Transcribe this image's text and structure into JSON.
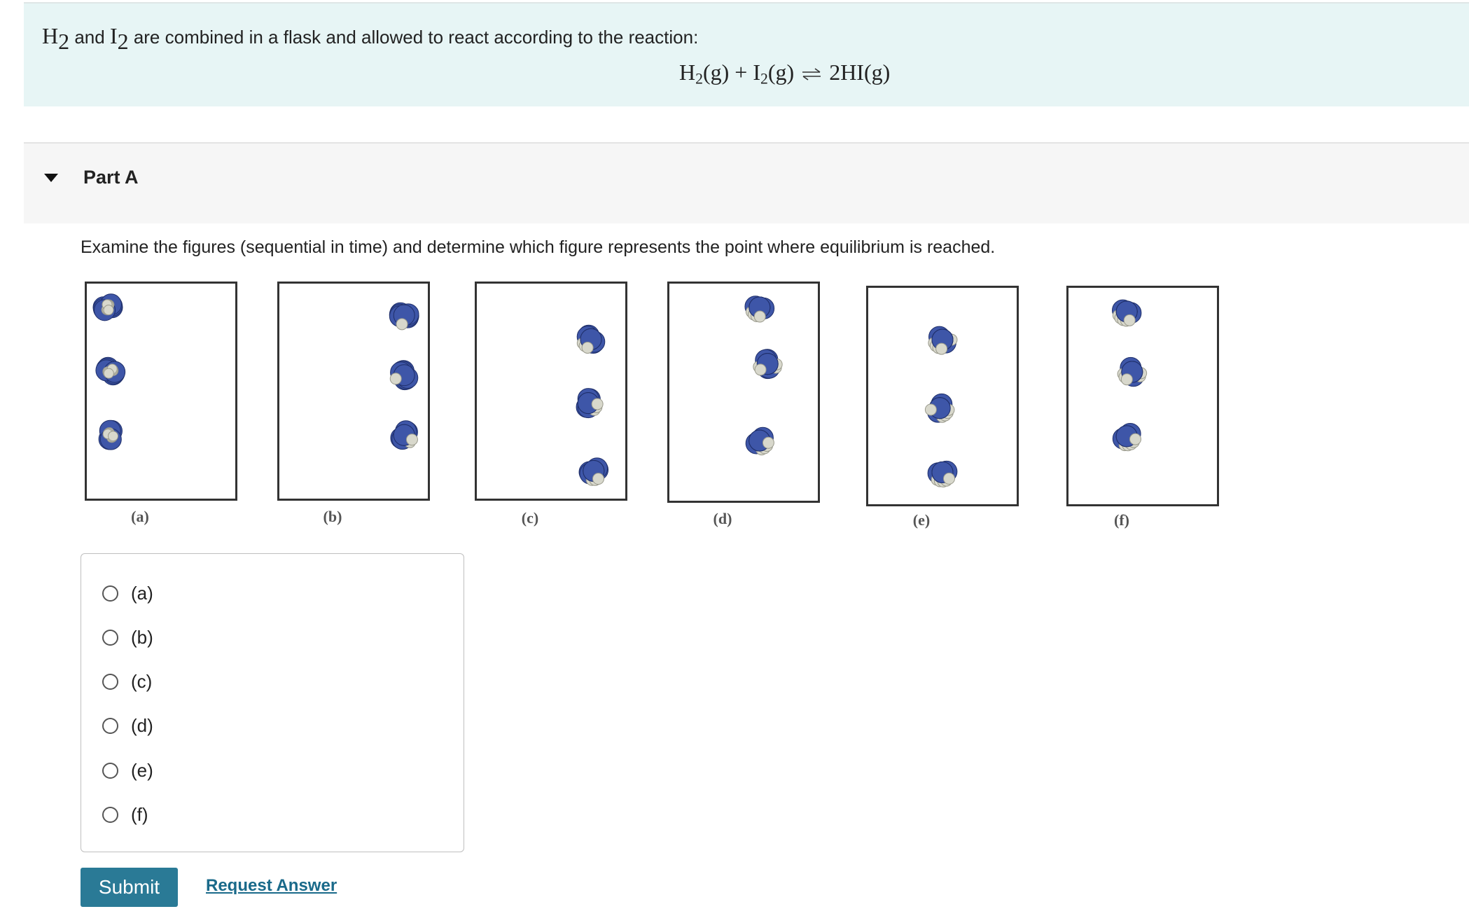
{
  "intro": {
    "h2": "H",
    "h2_sub": "2",
    "and": " and ",
    "i2": "I",
    "i2_sub": "2",
    "text_rest": " are combined in a flask and allowed to react according to the reaction:",
    "equation": {
      "left_a": "H",
      "left_a_sub": "2",
      "left_a_state": "(g) + I",
      "left_b_sub": "2",
      "left_b_state": "(g)",
      "right": "2HI(g)"
    }
  },
  "part": {
    "title": "Part A",
    "caret_icon": "triangle-down-icon"
  },
  "question": "Examine the figures (sequential in time) and determine which figure represents the point where equilibrium is reached.",
  "figures": [
    "(a)",
    "(b)",
    "(c)",
    "(d)",
    "(e)",
    "(f)"
  ],
  "options": [
    "(a)",
    "(b)",
    "(c)",
    "(d)",
    "(e)",
    "(f)"
  ],
  "buttons": {
    "submit": "Submit",
    "request_answer": "Request Answer"
  },
  "colors": {
    "iodine": "#3e56a8",
    "hydrogen": "#d8d8cc",
    "intro_bg": "#e7f5f5",
    "submit_bg": "#2a7a96",
    "link": "#1a6a8a"
  }
}
